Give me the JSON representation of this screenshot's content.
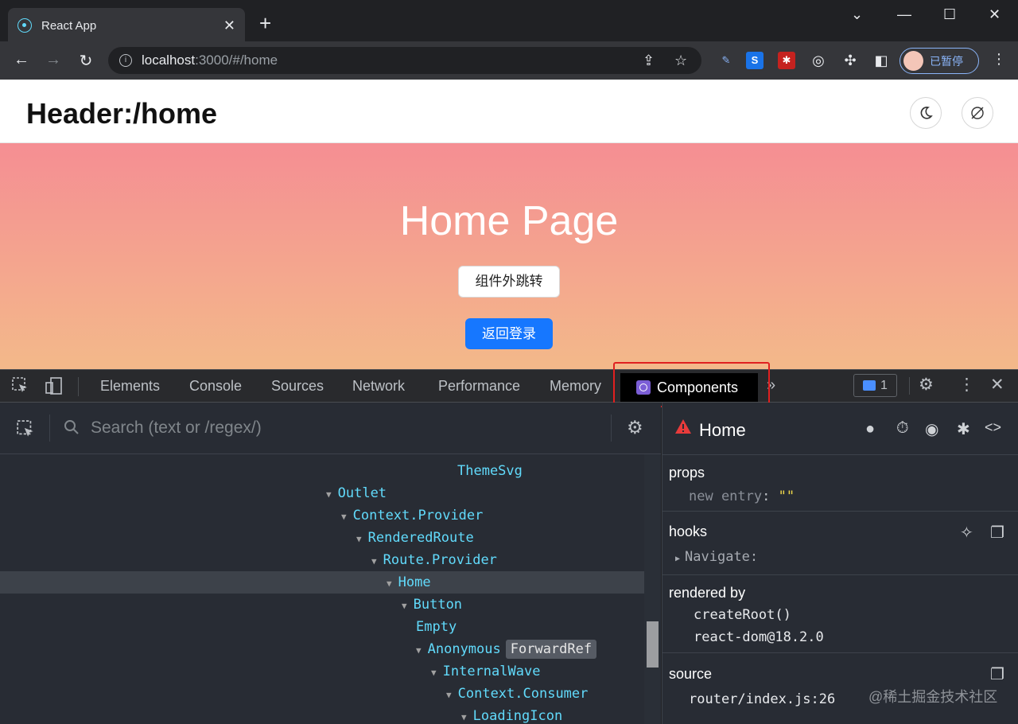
{
  "browser": {
    "tab_title": "React App",
    "url_host": "localhost",
    "url_path": ":3000/#/home",
    "profile_label": "已暂停",
    "ext_s_label": "S"
  },
  "page": {
    "header_title": "Header:/home",
    "hero_title": "Home Page",
    "jump_button": "组件外跳转",
    "login_button": "返回登录"
  },
  "devtools": {
    "tabs": [
      "Elements",
      "Console",
      "Sources",
      "Network",
      "Performance",
      "Memory"
    ],
    "active_tab": "Components",
    "more_tabs": "»",
    "messages_count": "1",
    "search_placeholder": "Search (text or /regex/)",
    "tree": [
      {
        "name": "ThemeSvg",
        "indent": 0,
        "arrow": false
      },
      {
        "name": "Outlet",
        "indent": 1,
        "arrow": true
      },
      {
        "name": "Context.Provider",
        "indent": 2,
        "arrow": true
      },
      {
        "name": "RenderedRoute",
        "indent": 3,
        "arrow": true
      },
      {
        "name": "Route.Provider",
        "indent": 4,
        "arrow": true
      },
      {
        "name": "Home",
        "indent": 5,
        "arrow": true,
        "selected": true
      },
      {
        "name": "Button",
        "indent": 6,
        "arrow": true
      },
      {
        "name": "Empty",
        "indent": 7,
        "arrow": false
      },
      {
        "name": "Anonymous",
        "indent": 7,
        "arrow": true,
        "badge": "ForwardRef"
      },
      {
        "name": "InternalWave",
        "indent": 8,
        "arrow": true
      },
      {
        "name": "Context.Consumer",
        "indent": 9,
        "arrow": true
      },
      {
        "name": "LoadingIcon",
        "indent": 10,
        "arrow": true
      }
    ],
    "inspector": {
      "component": "Home",
      "props_label": "props",
      "prop_key": "new entry",
      "prop_value": "\"\"",
      "hooks_label": "hooks",
      "hook_item": "Navigate",
      "rendered_by_label": "rendered by",
      "rendered_by": [
        "createRoot()",
        "react-dom@18.2.0"
      ],
      "source_label": "source",
      "source_value": "router/index.js:26"
    }
  },
  "watermark": "@稀土掘金技术社区",
  "colors": {
    "hero_top": "#f58e93",
    "hero_bottom": "#f3b98a",
    "primary_button": "#1677ff",
    "tree_text": "#61dafb",
    "highlight_box": "#e02020",
    "warning": "#e83b3b"
  }
}
